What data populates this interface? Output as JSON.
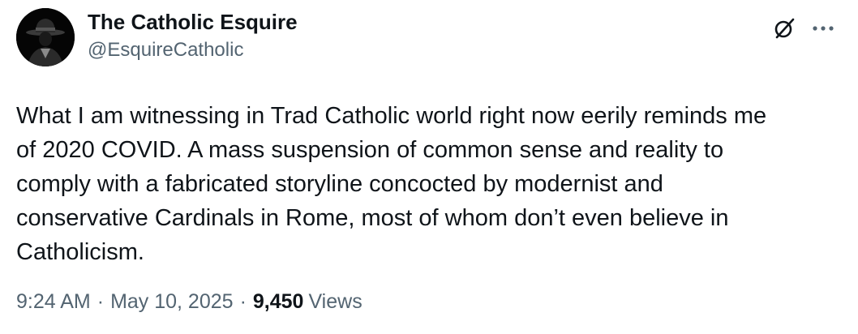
{
  "author": {
    "display_name": "The Catholic Esquire",
    "handle": "@EsquireCatholic",
    "avatar_icon": "avatar-hat-figure-icon"
  },
  "header_actions": {
    "grok_icon": "grok-icon",
    "more_icon": "more-options-icon"
  },
  "tweet": {
    "text": "What I am witnessing in Trad Catholic world right now eerily reminds me\nof 2020 COVID. A mass suspension of common sense and reality to\ncomply with a fabricated storyline concocted by modernist and\nconservative Cardinals in Rome, most of whom don’t even believe in\nCatholicism."
  },
  "meta": {
    "time": "9:24 AM",
    "separator": "·",
    "date": "May 10, 2025",
    "views_count": "9,450",
    "views_label": "Views"
  },
  "colors": {
    "text_primary": "#0f1419",
    "text_secondary": "#536471",
    "background": "#ffffff"
  }
}
